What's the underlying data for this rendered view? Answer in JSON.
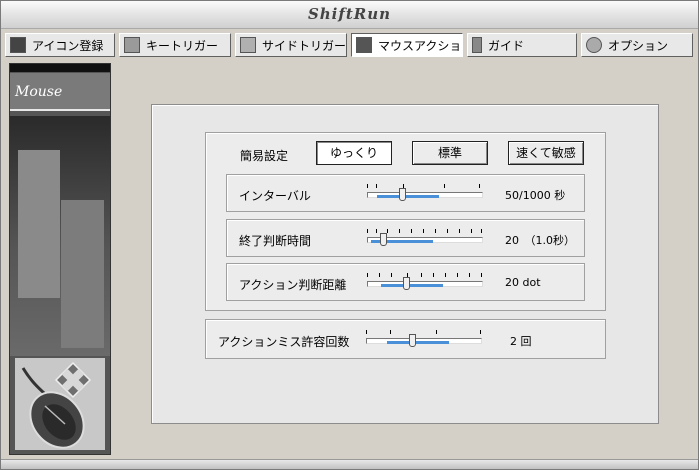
{
  "window": {
    "title": "ShiftRun"
  },
  "tabs": [
    {
      "label": "アイコン登録",
      "icon": "icon-register-icon",
      "active": false
    },
    {
      "label": "キートリガー",
      "icon": "key-trigger-icon",
      "active": false
    },
    {
      "label": "サイドトリガー",
      "icon": "side-trigger-icon",
      "active": false
    },
    {
      "label": "マウスアクション",
      "icon": "mouse-action-icon",
      "active": true
    },
    {
      "label": "ガイド",
      "icon": "guide-icon",
      "active": false
    },
    {
      "label": "オプション",
      "icon": "options-icon",
      "active": false
    }
  ],
  "sidebar": {
    "banner": "Mouse Action"
  },
  "preset": {
    "label": "簡易設定",
    "buttons": [
      "ゆっくり",
      "標準",
      "速くて敏感"
    ],
    "selected": "ゆっくり"
  },
  "settings": {
    "interval": {
      "label": "インターバル",
      "value_text": "50/1000 秒",
      "level": 0.3
    },
    "end_time": {
      "label": "終了判断時間",
      "value_text": "20　（1.0秒）",
      "level": 0.12
    },
    "distance": {
      "label": "アクション判断距離",
      "value_text": "20 dot",
      "level": 0.33
    }
  },
  "miss": {
    "label": "アクションミス許容回数",
    "value_text": "2 回",
    "level": 0.4
  },
  "colors": {
    "accent": "#4a90d9",
    "window_bg": "#d4d0c8",
    "panel_bg": "#e7e7e7"
  }
}
